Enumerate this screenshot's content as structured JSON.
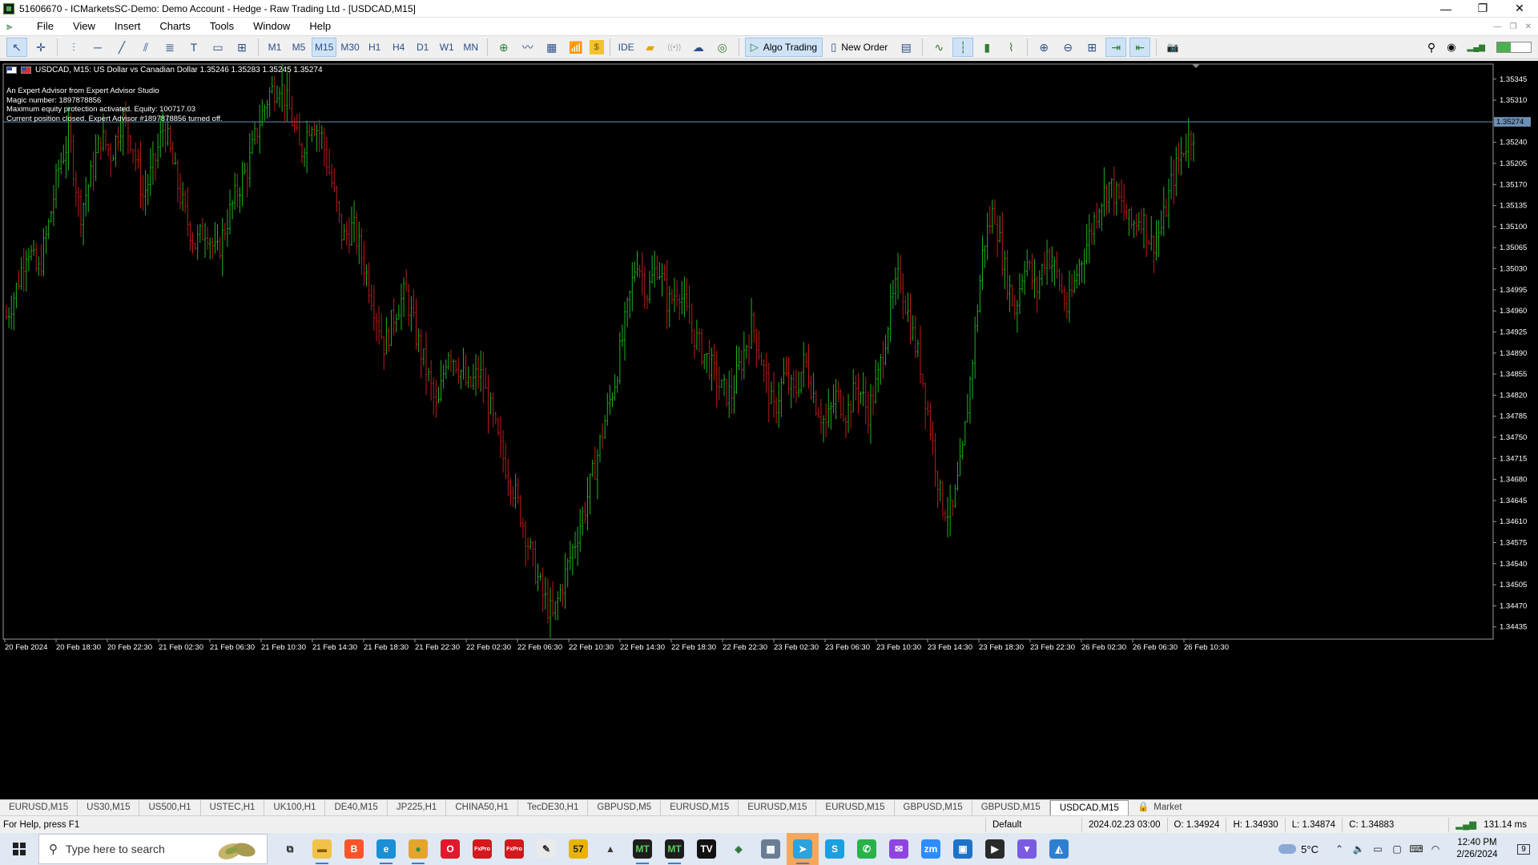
{
  "window": {
    "title": "51606670 - ICMarketsSC-Demo: Demo Account - Hedge - Raw Trading Ltd - [USDCAD,M15]",
    "minimize": "—",
    "restore": "❐",
    "close": "✕"
  },
  "menu": [
    "File",
    "View",
    "Insert",
    "Charts",
    "Tools",
    "Window",
    "Help"
  ],
  "toolbar": {
    "timeframes": [
      "M1",
      "M5",
      "M15",
      "M30",
      "H1",
      "H4",
      "D1",
      "W1",
      "MN"
    ],
    "active_timeframe": "M15",
    "ide_label": "IDE",
    "algo_trading_label": "Algo Trading",
    "new_order_label": "New Order"
  },
  "chart": {
    "header": "USDCAD, M15:  US Dollar vs Canadian Dollar  1.35246 1.35283 1.35245 1.35274",
    "ea_comments": [
      "An Expert Advisor from Expert Advisor Studio",
      "Magic number: 1897878856",
      "Maximum equity protection activated. Equity: 100717.03",
      "Current position closed. Expert Advisor #1897878856 turned off."
    ],
    "price_labels": [
      "1.35345",
      "1.35310",
      "1.35240",
      "1.35205",
      "1.35170",
      "1.35135",
      "1.35100",
      "1.35065",
      "1.35030",
      "1.34995",
      "1.34960",
      "1.34925",
      "1.34890",
      "1.34855",
      "1.34820",
      "1.34785",
      "1.34750",
      "1.34715",
      "1.34680",
      "1.34645",
      "1.34610",
      "1.34575",
      "1.34540",
      "1.34505",
      "1.34470",
      "1.34435"
    ],
    "current_price": "1.35274",
    "time_labels": [
      "20 Feb 2024",
      "20 Feb 18:30",
      "20 Feb 22:30",
      "21 Feb 02:30",
      "21 Feb 06:30",
      "21 Feb 10:30",
      "21 Feb 14:30",
      "21 Feb 18:30",
      "21 Feb 22:30",
      "22 Feb 02:30",
      "22 Feb 06:30",
      "22 Feb 10:30",
      "22 Feb 14:30",
      "22 Feb 18:30",
      "22 Feb 22:30",
      "23 Feb 02:30",
      "23 Feb 06:30",
      "23 Feb 10:30",
      "23 Feb 14:30",
      "23 Feb 18:30",
      "23 Feb 22:30",
      "26 Feb 02:30",
      "26 Feb 06:30",
      "26 Feb 10:30"
    ],
    "colors": {
      "background": "#000000",
      "bull": "#1fb21f",
      "bear": "#c21a1a",
      "price_line": "#6d8fb5",
      "axis_text": "#ffffff"
    }
  },
  "chart_data": {
    "type": "ohlc",
    "symbol": "USDCAD",
    "timeframe": "M15",
    "ylim": [
      1.3442,
      1.3537
    ],
    "bid_line": 1.35274,
    "path_closes": [
      1.3495,
      1.35,
      1.3507,
      1.3502,
      1.351,
      1.352,
      1.3525,
      1.3512,
      1.3518,
      1.3525,
      1.3522,
      1.3528,
      1.3524,
      1.3515,
      1.352,
      1.3527,
      1.3519,
      1.3512,
      1.3507,
      1.351,
      1.3505,
      1.3511,
      1.3516,
      1.352,
      1.3527,
      1.3532,
      1.3534,
      1.3529,
      1.3522,
      1.3528,
      1.3525,
      1.3517,
      1.3508,
      1.351,
      1.3504,
      1.3497,
      1.349,
      1.3496,
      1.3499,
      1.3492,
      1.3486,
      1.3479,
      1.349,
      1.3487,
      1.3483,
      1.3486,
      1.348,
      1.3473,
      1.3468,
      1.3462,
      1.3455,
      1.3449,
      1.3445,
      1.3451,
      1.3457,
      1.3463,
      1.347,
      1.3478,
      1.3485,
      1.3495,
      1.3505,
      1.3499,
      1.3504,
      1.3497,
      1.35,
      1.3494,
      1.349,
      1.3487,
      1.3483,
      1.3482,
      1.3488,
      1.3494,
      1.3487,
      1.3479,
      1.3485,
      1.3482,
      1.3488,
      1.3481,
      1.3477,
      1.3482,
      1.3479,
      1.3484,
      1.3479,
      1.3485,
      1.3495,
      1.3502,
      1.3494,
      1.3487,
      1.3476,
      1.3464,
      1.3462,
      1.3472,
      1.3489,
      1.3507,
      1.3513,
      1.3503,
      1.3496,
      1.3505,
      1.3499,
      1.3506,
      1.3502,
      1.3496,
      1.3503,
      1.3508,
      1.3514,
      1.3517,
      1.3514,
      1.351,
      1.3512,
      1.3507,
      1.351,
      1.3518,
      1.3523,
      1.3526
    ]
  },
  "symbol_tabs": [
    "EURUSD,M15",
    "US30,M15",
    "US500,H1",
    "USTEC,H1",
    "UK100,H1",
    "DE40,M15",
    "JP225,H1",
    "CHINA50,H1",
    "TecDE30,H1",
    "GBPUSD,M5",
    "EURUSD,M15",
    "EURUSD,M15",
    "EURUSD,M15",
    "GBPUSD,M15",
    "GBPUSD,M15",
    "USDCAD,M15",
    "Market"
  ],
  "active_symbol_tab": "USDCAD,M15",
  "status": {
    "help": "For Help, press F1",
    "profile": "Default",
    "datetime": "2024.02.23 03:00",
    "open": "O: 1.34924",
    "high": "H: 1.34930",
    "low": "L: 1.34874",
    "close": "C: 1.34883",
    "ping": "131.14 ms"
  },
  "taskbar": {
    "search_placeholder": "Type here to search",
    "temperature": "5°C",
    "time": "12:40 PM",
    "date": "2/26/2024",
    "notification_count": "9",
    "apps": [
      {
        "name": "task-view",
        "label": "⧉",
        "color": "#dfe8f3",
        "fg": "#222"
      },
      {
        "name": "file-explorer",
        "label": "▬",
        "color": "#f1c24a",
        "fg": "#8a5a00"
      },
      {
        "name": "brave",
        "label": "B",
        "color": "#fb542b",
        "fg": "#fff"
      },
      {
        "name": "edge",
        "label": "e",
        "color": "#1a8fd6",
        "fg": "#fff"
      },
      {
        "name": "chrome",
        "label": "●",
        "color": "#e4a52c",
        "fg": "#2f8f3e"
      },
      {
        "name": "opera",
        "label": "O",
        "color": "#e3172d",
        "fg": "#fff"
      },
      {
        "name": "app-red-1",
        "label": "FxPro",
        "color": "#d5171e",
        "fg": "#fff"
      },
      {
        "name": "app-red-2",
        "label": "FxPro",
        "color": "#d5171e",
        "fg": "#fff"
      },
      {
        "name": "app-inkscape",
        "label": "✎",
        "color": "#eaeaea",
        "fg": "#222"
      },
      {
        "name": "app-57",
        "label": "57",
        "color": "#e8b400",
        "fg": "#222"
      },
      {
        "name": "app-triangle",
        "label": "▲",
        "color": "#dfe8f3",
        "fg": "#3b3b3b"
      },
      {
        "name": "metatrader-1",
        "label": "MT",
        "color": "#1d1d1d",
        "fg": "#5acb5a"
      },
      {
        "name": "metatrader-2",
        "label": "MT",
        "color": "#1d1d1d",
        "fg": "#5acb5a"
      },
      {
        "name": "tradingview",
        "label": "TV",
        "color": "#121212",
        "fg": "#fff"
      },
      {
        "name": "app-network",
        "label": "◈",
        "color": "#dfe8f3",
        "fg": "#2a6f3a"
      },
      {
        "name": "calculator",
        "label": "▦",
        "color": "#6b7d93",
        "fg": "#fff"
      },
      {
        "name": "telegram",
        "label": "➤",
        "color": "#2aa3df",
        "fg": "#fff"
      },
      {
        "name": "skype",
        "label": "S",
        "color": "#1a9fe0",
        "fg": "#fff"
      },
      {
        "name": "whatsapp",
        "label": "✆",
        "color": "#29b24a",
        "fg": "#fff"
      },
      {
        "name": "messenger",
        "label": "✉",
        "color": "#8e44e0",
        "fg": "#fff"
      },
      {
        "name": "zoom",
        "label": "zm",
        "color": "#2d8cff",
        "fg": "#fff"
      },
      {
        "name": "app-box",
        "label": "▣",
        "color": "#1e73c8",
        "fg": "#fff"
      },
      {
        "name": "media-player",
        "label": "▶",
        "color": "#2a2a2a",
        "fg": "#fff"
      },
      {
        "name": "app-v",
        "label": "▼",
        "color": "#7a5be0",
        "fg": "#fff"
      },
      {
        "name": "photos",
        "label": "◭",
        "color": "#2f7fd0",
        "fg": "#fff"
      }
    ]
  },
  "icons": {
    "cursor": "↖",
    "crosshair": "✛",
    "vline": "⫶",
    "hline": "─",
    "trendline": "╱",
    "channel": "⫽",
    "fibo": "≣",
    "text": "T",
    "rect": "▭",
    "shapes": "⊞",
    "add_indicator": "⊕",
    "line_chart": "〰",
    "chart_type": "▦",
    "indicators": "📶",
    "coin": "$",
    "ide": "IDE",
    "folder": "▰",
    "signals": "((•))",
    "cloud": "☁",
    "vps": "◎",
    "algo_play": "▷",
    "new_order": "▯",
    "depth": "▤",
    "chart_line": "∿",
    "bars": "┆",
    "candles": "▮",
    "line": "⌇",
    "zoom_in": "⊕",
    "zoom_out": "⊖",
    "tile": "⊞",
    "autoscroll": "⇥",
    "chart_shift": "⇤",
    "screenshot": "📷",
    "search": "⚲",
    "account": "◉",
    "signal": "▂▄▆"
  }
}
